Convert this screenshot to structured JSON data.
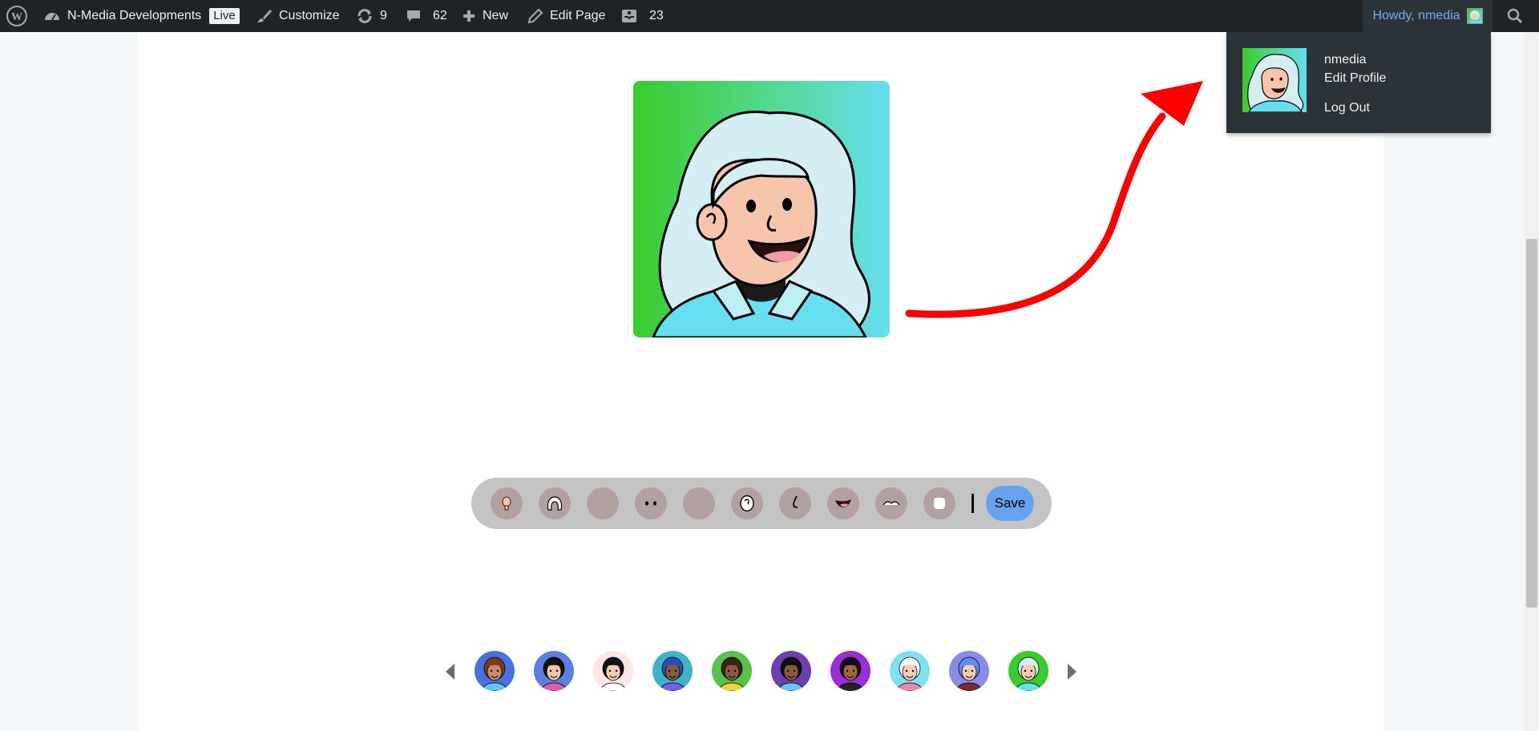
{
  "adminbar": {
    "site_name": "N-Media Developments",
    "live_badge": "Live",
    "customize": "Customize",
    "updates_count": "9",
    "comments_count": "62",
    "new_label": "New",
    "edit_page": "Edit Page",
    "forms_count": "23",
    "howdy": "Howdy, nmedia"
  },
  "user_menu": {
    "username": "nmedia",
    "edit_profile": "Edit Profile",
    "logout": "Log Out"
  },
  "toolbar": {
    "save_label": "Save",
    "tools": [
      "skin-icon",
      "hair-icon",
      "background-icon",
      "eyes-icon",
      "face-icon",
      "ear-icon",
      "nose-icon",
      "mouth-icon",
      "beard-icon",
      "shirt-icon"
    ]
  },
  "colors": {
    "adminbar_bg": "#1d2327",
    "dropdown_bg": "#2c3338",
    "accent_link": "#72aee6",
    "save_button": "#66a3ef",
    "toolbar_bg": "#c4c4c4",
    "tool_button": "#b3a0a0",
    "preview_gradient_start": "#38cc2c",
    "preview_gradient_end": "#66dff1",
    "annotation_arrow": "#ff0000"
  },
  "carousel": {
    "avatars": [
      {
        "bg": "#4a6fe0",
        "skin": "#c98a6a",
        "hair": "#7a3b1a",
        "shirt": "#66c6ef"
      },
      {
        "bg": "#5b7fe0",
        "skin": "#f3c6a8",
        "hair": "#111111",
        "shirt": "#e35ba8"
      },
      {
        "bg": "#fde6e6",
        "skin": "#f5cdb2",
        "hair": "#111111",
        "shirt": "#ffffff"
      },
      {
        "bg": "#3fb3c8",
        "skin": "#8a5a3c",
        "hair": "#2a4fbf",
        "shirt": "#7f5cf0"
      },
      {
        "bg": "#57c24a",
        "skin": "#8a5a3c",
        "hair": "#3a2414",
        "shirt": "#f3d23a"
      },
      {
        "bg": "#6b3fb0",
        "skin": "#8a5a3c",
        "hair": "#111111",
        "shirt": "#66c6ef"
      },
      {
        "bg": "#9c2cd8",
        "skin": "#a0663f",
        "hair": "#111111",
        "shirt": "#222222"
      },
      {
        "bg": "#7fe0ef",
        "skin": "#f5cdb2",
        "hair": "#ffffff",
        "shirt": "#f087a8"
      },
      {
        "bg": "#8a8ae8",
        "skin": "#f5cdb2",
        "hair": "#5e8ff0",
        "shirt": "#7a2a2a"
      },
      {
        "bg": "#38cc2c",
        "skin": "#f5cdb2",
        "hair": "#d4eef3",
        "shirt": "#66dff1"
      }
    ]
  }
}
